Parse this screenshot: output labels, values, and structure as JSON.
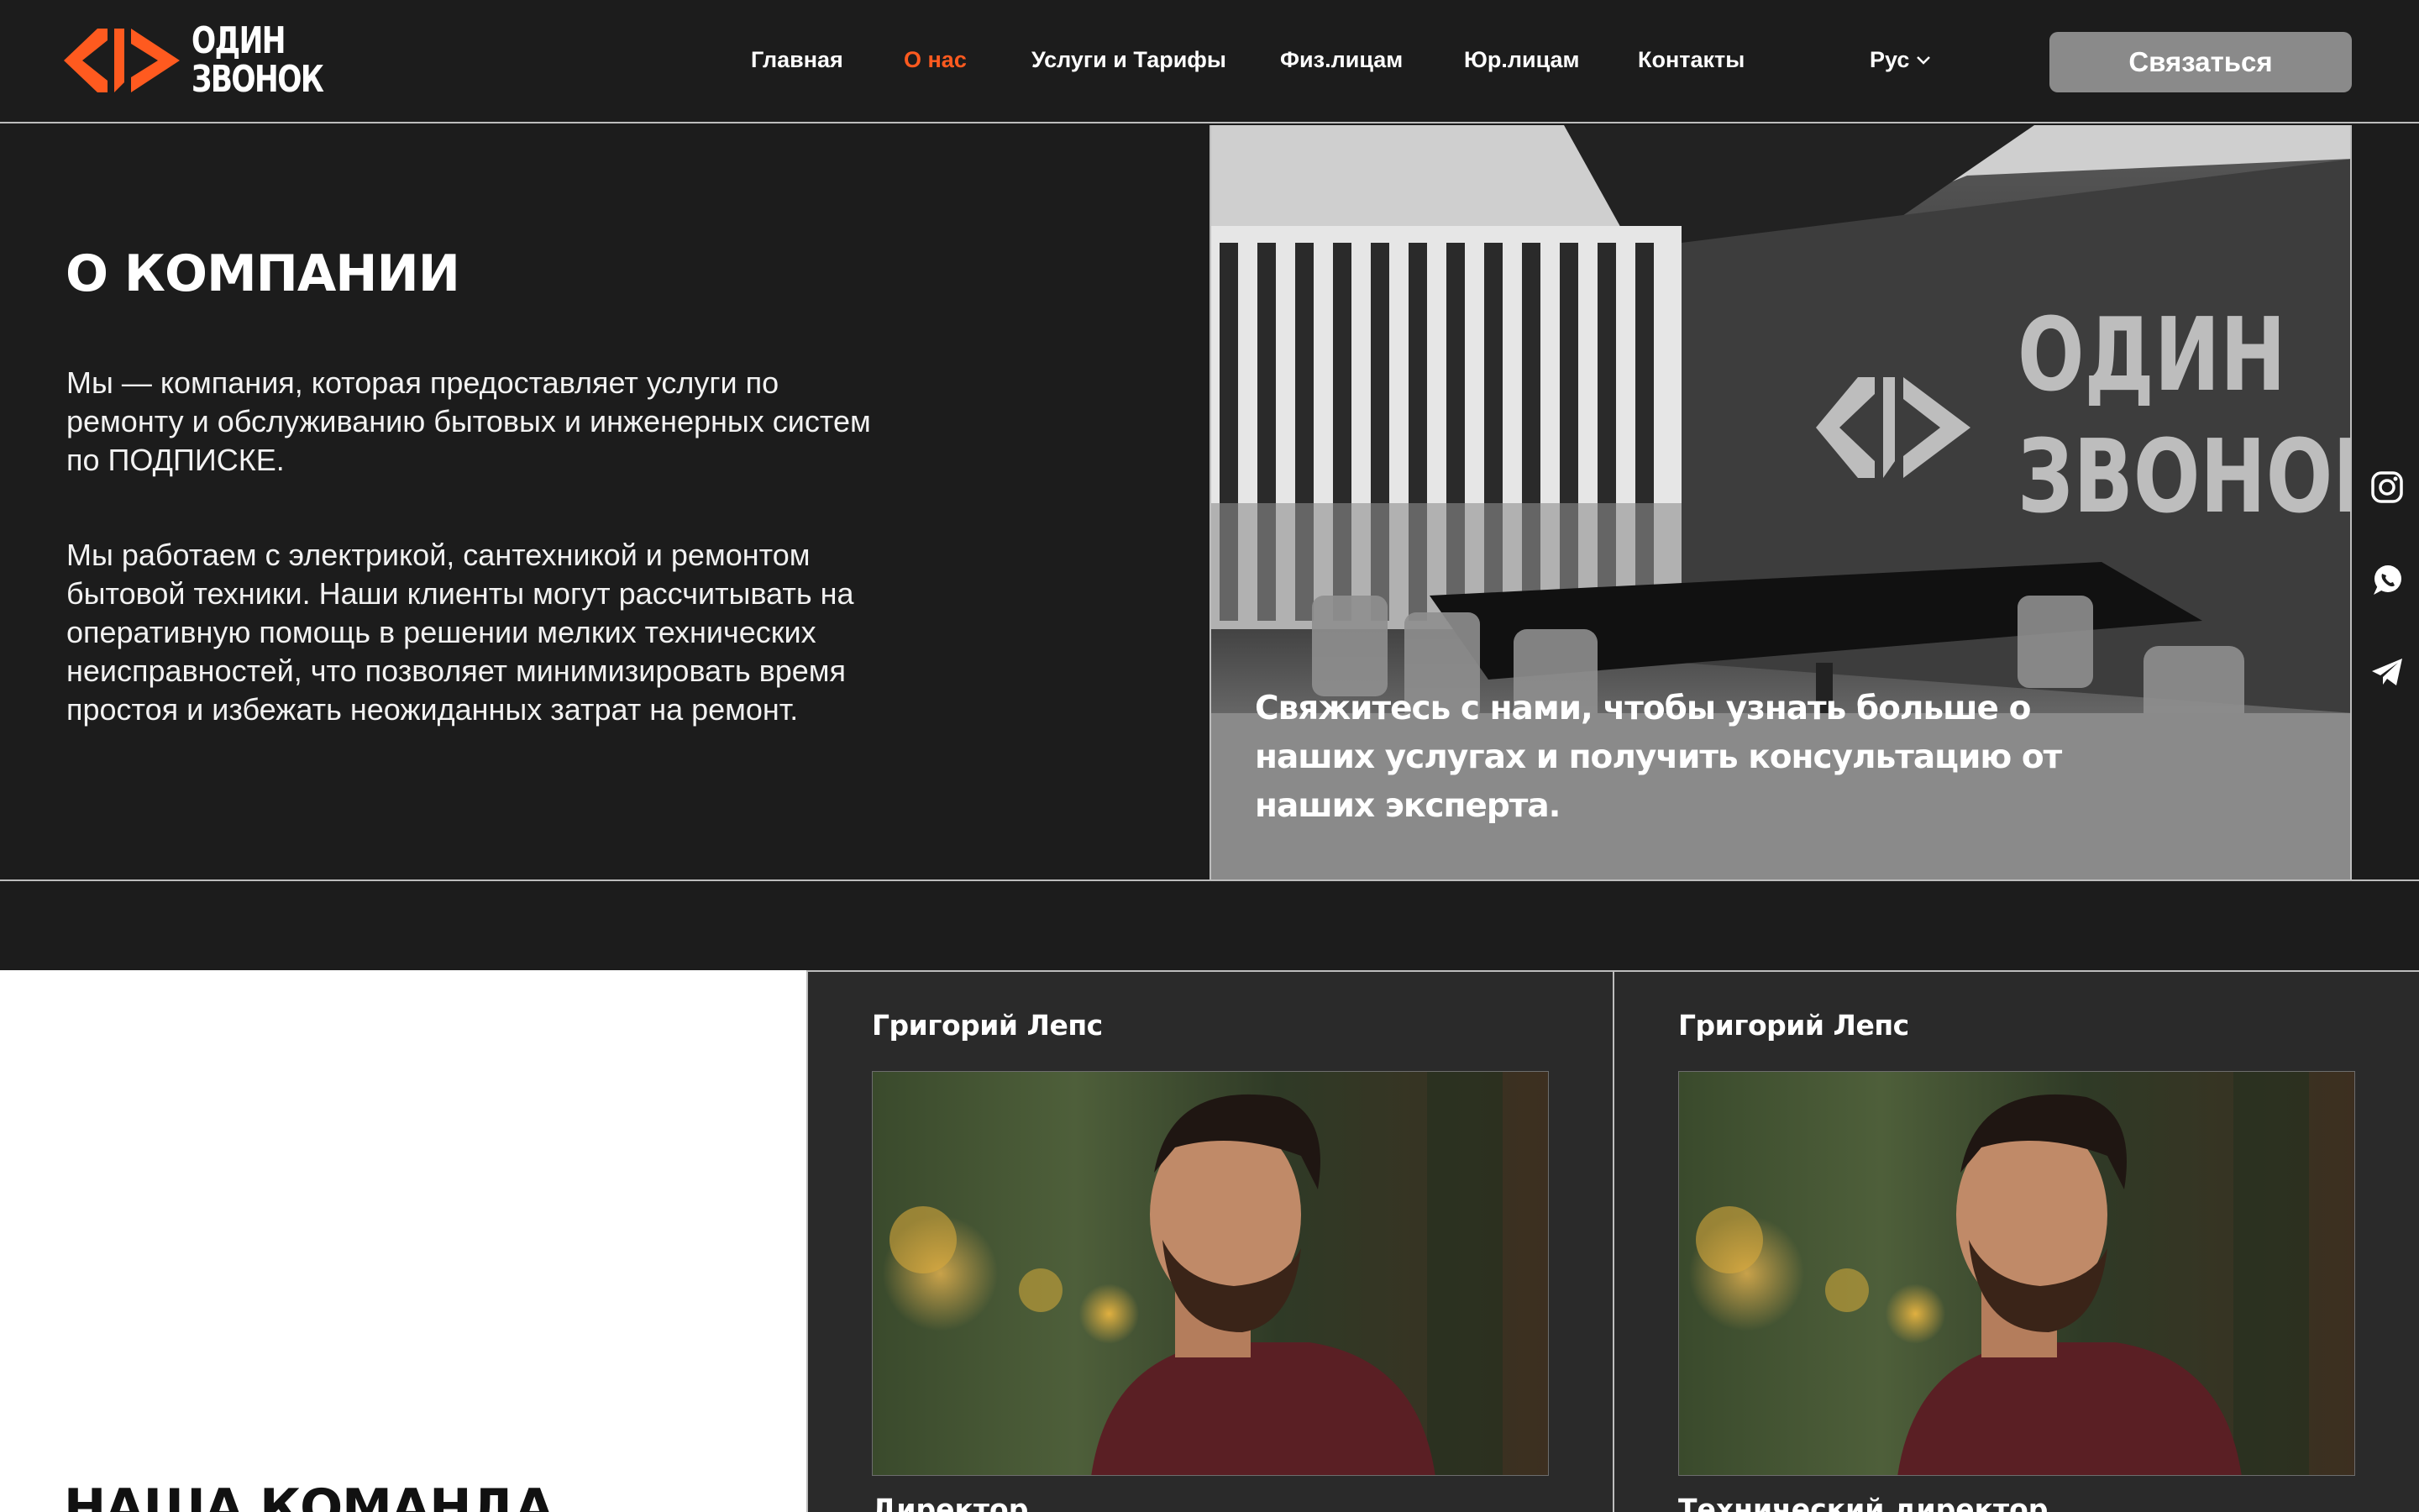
{
  "brand": {
    "name_line1": "ОДИН",
    "name_line2": "ЗВОНОК",
    "accent_color": "#ff5a1f"
  },
  "nav": {
    "items": [
      {
        "label": "Главная",
        "active": false
      },
      {
        "label": "О нас",
        "active": true
      },
      {
        "label": "Услуги и Тарифы",
        "active": false
      },
      {
        "label": "Физ.лицам",
        "active": false
      },
      {
        "label": "Юр.лицам",
        "active": false
      },
      {
        "label": "Контакты",
        "active": false
      }
    ],
    "language": "Рус",
    "contact_button": "Связаться"
  },
  "about": {
    "title": "О КОМПАНИИ",
    "paragraph1": "Мы — компания, которая предоставляет услуги по ремонту и обслуживанию бытовых и инженерных систем по ПОДПИСКЕ.",
    "paragraph2": "Мы работаем с электрикой, сантехникой и ремонтом бытовой техники. Наши клиенты могут рассчитывать на оперативную помощь в решении мелких технических неисправностей, что позволяет минимизировать время простоя и избежать неожиданных затрат на ремонт.",
    "photo_caption": "Свяжитесь с нами, чтобы узнать больше о наших услугах и получить консультацию от наших эксперта.",
    "photo_sign_line1": "ОДИН",
    "photo_sign_line2": "ЗВОНОК"
  },
  "social": [
    "instagram-icon",
    "whatsapp-icon",
    "telegram-icon"
  ],
  "team": {
    "title": "НАША КОМАНДА",
    "members": [
      {
        "name": "Григорий Лепс",
        "role": "Директор"
      },
      {
        "name": "Григорий Лепс",
        "role": "Технический директор"
      }
    ]
  }
}
